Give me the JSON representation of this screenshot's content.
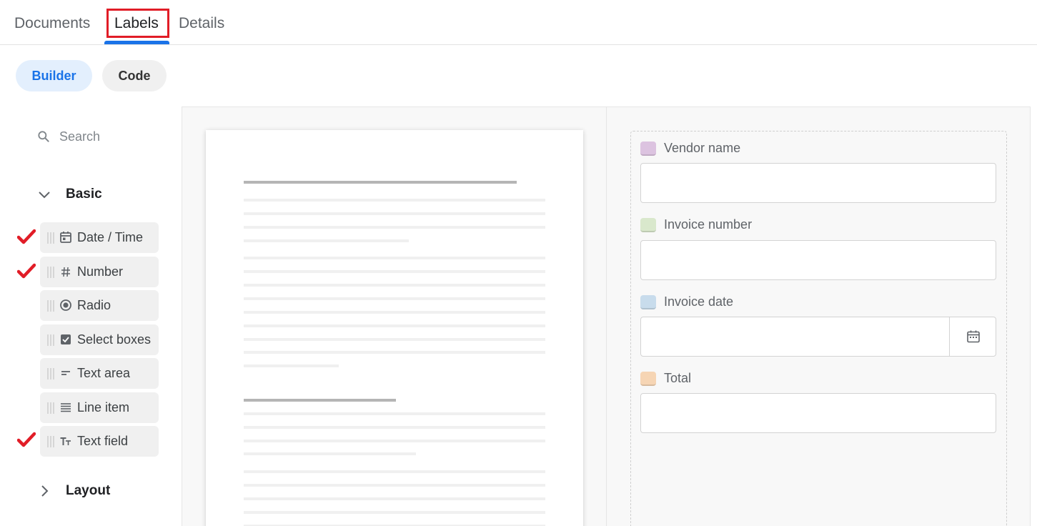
{
  "tabs": {
    "items": [
      {
        "label": "Documents"
      },
      {
        "label": "Labels"
      },
      {
        "label": "Details"
      }
    ],
    "active": "Labels"
  },
  "mode": {
    "builder_label": "Builder",
    "code_label": "Code",
    "active": "Builder"
  },
  "sidebar": {
    "search_placeholder": "Search",
    "sections": [
      {
        "title": "Basic",
        "expanded": true
      },
      {
        "title": "Layout",
        "expanded": false
      }
    ],
    "components": [
      {
        "label": "Date / Time",
        "icon": "calendar-icon",
        "checked": true
      },
      {
        "label": "Number",
        "icon": "hash-icon",
        "checked": true
      },
      {
        "label": "Radio",
        "icon": "radio-icon",
        "checked": false
      },
      {
        "label": "Select boxes",
        "icon": "checkbox-icon",
        "checked": false
      },
      {
        "label": "Text area",
        "icon": "short-text-icon",
        "checked": false
      },
      {
        "label": "Line item",
        "icon": "lines-icon",
        "checked": false
      },
      {
        "label": "Text field",
        "icon": "text-format-icon",
        "checked": true
      }
    ]
  },
  "form": {
    "fields": [
      {
        "label": "Vendor name",
        "color": "#dcc3e0",
        "value": ""
      },
      {
        "label": "Invoice number",
        "color": "#d9e8cc",
        "value": ""
      },
      {
        "label": "Invoice date",
        "color": "#c8dcec",
        "value": "",
        "has_calendar": true
      },
      {
        "label": "Total",
        "color": "#f6d5b4",
        "value": ""
      }
    ]
  },
  "colors": {
    "accent": "#1a73e8",
    "highlight_box": "#e11d27",
    "check_mark": "#e11d27"
  }
}
